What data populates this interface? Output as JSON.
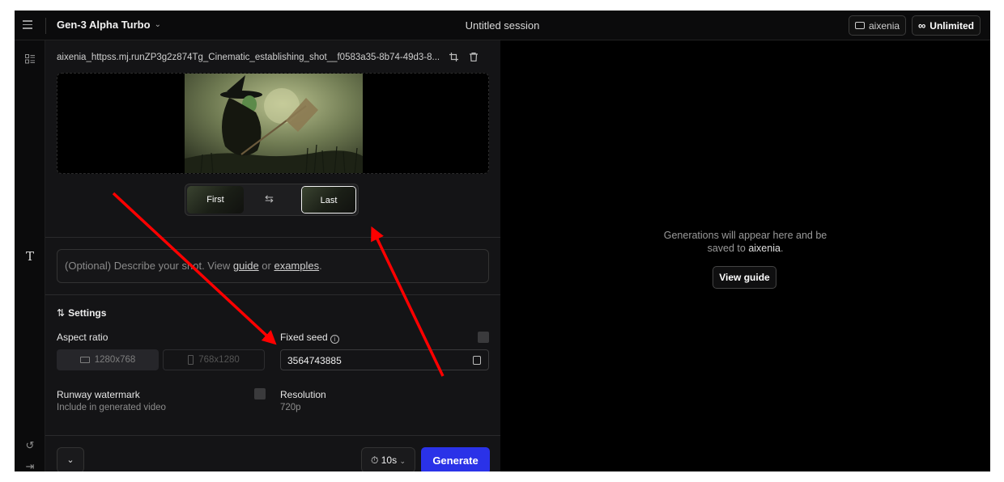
{
  "topbar": {
    "model": "Gen-3 Alpha Turbo",
    "session_title": "Untitled session",
    "folder_label": "aixenia",
    "unlimited_label": "Unlimited"
  },
  "panel": {
    "file_name": "aixenia_httpss.mj.runZP3g2z874Tg_Cinematic_establishing_shot__f0583a35-8b74-49d3-8...",
    "frame_first_label": "First",
    "frame_last_label": "Last",
    "prompt": {
      "prefix": "(Optional) Describe your shot. View ",
      "guide_link": "guide",
      "middle": " or ",
      "examples_link": "examples",
      "suffix": "."
    },
    "settings": {
      "title": "Settings",
      "aspect_ratio_label": "Aspect ratio",
      "aspect_options": [
        "1280x768",
        "768x1280"
      ],
      "fixed_seed_label": "Fixed seed",
      "seed_value": "3564743885",
      "watermark_label": "Runway watermark",
      "watermark_sub": "Include in generated video",
      "resolution_label": "Resolution",
      "resolution_value": "720p"
    },
    "footer": {
      "duration": "10s",
      "generate_label": "Generate"
    }
  },
  "output": {
    "message_line1": "Generations will appear here and be",
    "message_line2_prefix": "saved to ",
    "message_line2_highlight": "aixenia",
    "message_line2_suffix": ".",
    "view_guide_label": "View guide"
  },
  "colors": {
    "accent": "#2a32e8",
    "annotation_arrow": "#ff0000",
    "panel_bg": "#141416"
  }
}
